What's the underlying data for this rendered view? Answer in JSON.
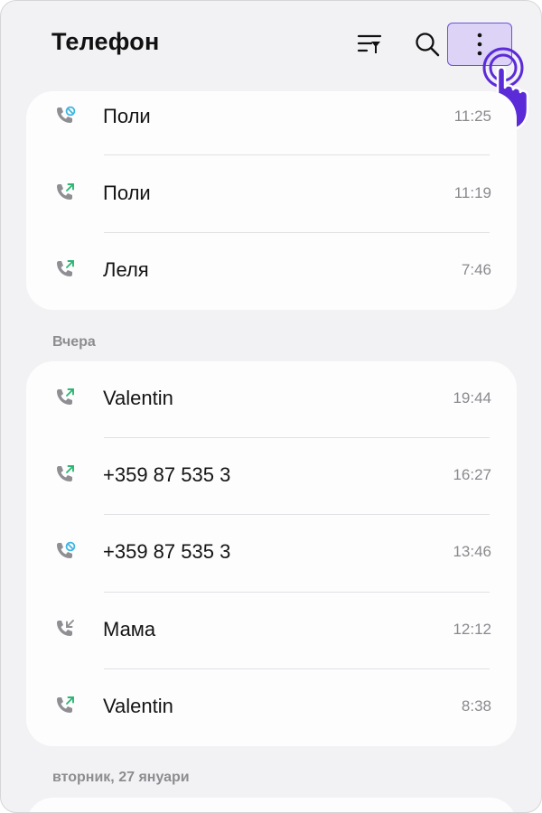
{
  "header": {
    "title": "Телефон",
    "icons": {
      "filter": "filter-sort-icon",
      "search": "search-icon",
      "more": "more-vertical-icon"
    }
  },
  "today": {
    "items": [
      {
        "name": "Поли",
        "time": "11:25",
        "type": "blocked",
        "icon": "blocked-call-icon"
      },
      {
        "name": "Поли",
        "time": "11:19",
        "type": "outgoing",
        "icon": "outgoing-call-icon"
      },
      {
        "name": "Леля",
        "time": "7:46",
        "type": "outgoing",
        "icon": "outgoing-call-icon"
      }
    ]
  },
  "yesterday": {
    "label": "Вчера",
    "items": [
      {
        "name": "Valentin",
        "time": "19:44",
        "type": "outgoing",
        "icon": "outgoing-call-icon"
      },
      {
        "name": "+359 87 535 3",
        "time": "16:27",
        "type": "outgoing",
        "icon": "outgoing-call-icon"
      },
      {
        "name": "+359 87 535 3",
        "time": "13:46",
        "type": "blocked",
        "icon": "blocked-call-icon"
      },
      {
        "name": "Мама",
        "time": "12:12",
        "type": "incoming",
        "icon": "incoming-call-icon"
      },
      {
        "name": "Valentin",
        "time": "8:38",
        "type": "outgoing",
        "icon": "outgoing-call-icon"
      }
    ]
  },
  "earlier": {
    "label": "вторник, 27 януари"
  },
  "colors": {
    "outgoing": "#2bb673",
    "blocked": "#3fb5e0",
    "incoming": "#8e8e93",
    "accent": "#6a55d6"
  }
}
